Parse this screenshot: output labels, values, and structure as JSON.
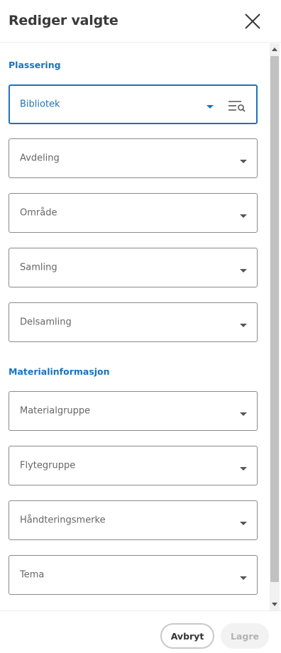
{
  "header": {
    "title": "Rediger valgte",
    "close_icon": "close-icon"
  },
  "sections": {
    "location": {
      "title": "Plassering",
      "fields": {
        "library": {
          "label": "Bibliotek",
          "icon": "list-search-icon",
          "active": true
        },
        "department": {
          "label": "Avdeling"
        },
        "area": {
          "label": "Område"
        },
        "collection": {
          "label": "Samling"
        },
        "subcollection": {
          "label": "Delsamling"
        }
      }
    },
    "material": {
      "title": "Materialinformasjon",
      "fields": {
        "material_group": {
          "label": "Materialgruppe"
        },
        "float_group": {
          "label": "Flytegruppe"
        },
        "handling_mark": {
          "label": "Håndteringsmerke"
        },
        "theme": {
          "label": "Tema"
        }
      }
    }
  },
  "footer": {
    "cancel_label": "Avbryt",
    "save_label": "Lagre",
    "save_disabled": true
  },
  "colors": {
    "accent": "#1a73c0",
    "border": "#8a8a8a",
    "disabled_bg": "#f2f2f2",
    "disabled_text": "#b3b3b3"
  }
}
